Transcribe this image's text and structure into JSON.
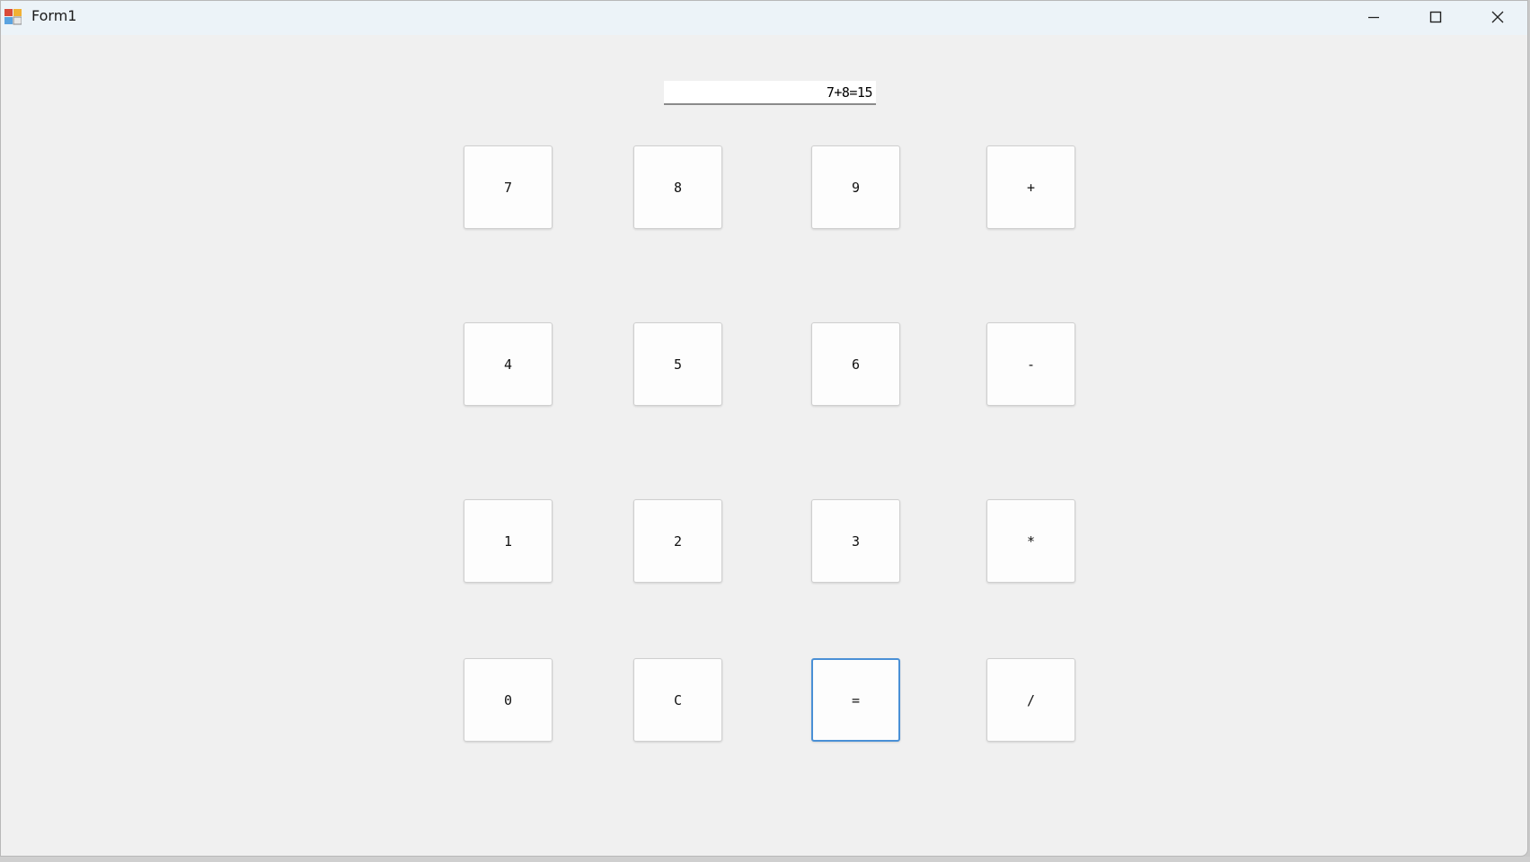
{
  "window": {
    "title": "Form1",
    "controls": {
      "minimize": "minimize-icon",
      "maximize": "maximize-icon",
      "close": "close-icon"
    }
  },
  "display": {
    "value": "7+8=15"
  },
  "keys": [
    [
      "7",
      "8",
      "9",
      "+"
    ],
    [
      "4",
      "5",
      "6",
      "-"
    ],
    [
      "1",
      "2",
      "3",
      "*"
    ],
    [
      "0",
      "C",
      "=",
      "/"
    ]
  ],
  "focused_key": "=",
  "colors": {
    "background": "#f0f0f0",
    "titlebar": "#ecf3f8",
    "focus_border": "#4a90d6"
  }
}
